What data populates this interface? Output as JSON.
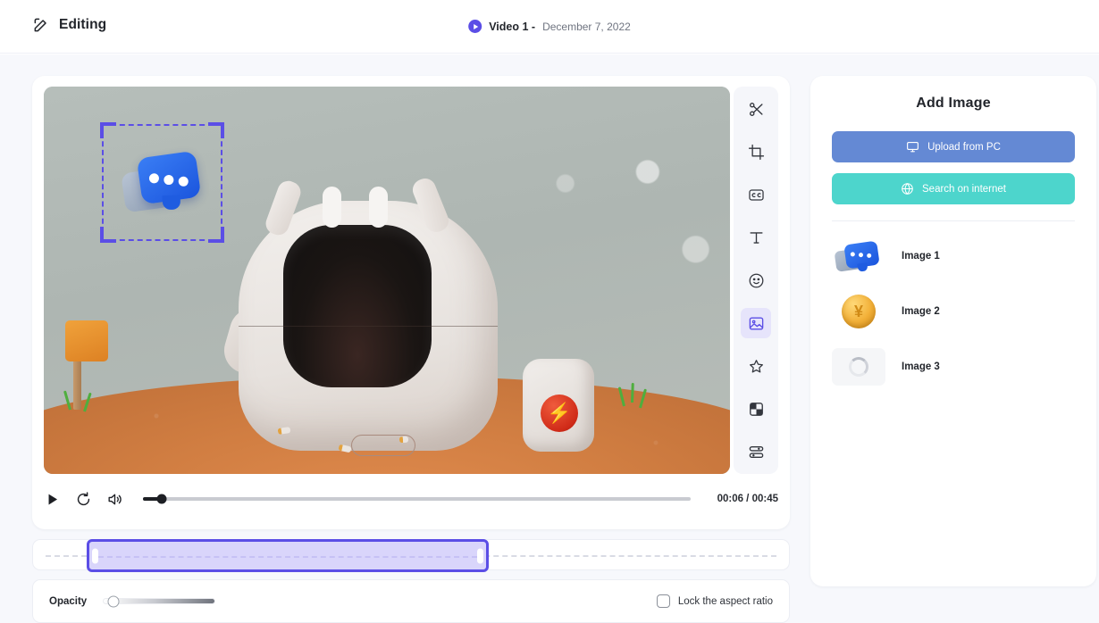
{
  "header": {
    "edit_icon": "edit-square-icon",
    "editing_label": "Editing",
    "play_icon": "play-circle-icon",
    "video_title": "Video 1 -",
    "video_date": "December 7, 2022"
  },
  "toolbar": {
    "items": [
      {
        "name": "cut-tool",
        "icon": "scissors-icon",
        "active": false
      },
      {
        "name": "crop-tool",
        "icon": "crop-icon",
        "active": false
      },
      {
        "name": "captions-tool",
        "icon": "closed-captions-icon",
        "active": false
      },
      {
        "name": "text-tool",
        "icon": "text-icon",
        "active": false
      },
      {
        "name": "sticker-tool",
        "icon": "smiley-icon",
        "active": false
      },
      {
        "name": "image-tool",
        "icon": "image-icon",
        "active": true
      },
      {
        "name": "effects-tool",
        "icon": "star-icon",
        "active": false
      },
      {
        "name": "transition-tool",
        "icon": "checkerboard-icon",
        "active": false
      },
      {
        "name": "adjustments-tool",
        "icon": "sliders-icon",
        "active": false
      }
    ]
  },
  "player": {
    "play_icon": "play-icon",
    "restart_icon": "restart-icon",
    "volume_icon": "volume-icon",
    "current_time": "00:06",
    "total_time": "00:45",
    "time_display": "00:06 / 00:45",
    "progress_percent": 3.5
  },
  "timeline": {
    "selection_start_percent": 7,
    "selection_width_percent": 54,
    "accent_color": "#5b4ee6",
    "fill_color": "#d9d5fb"
  },
  "bottom": {
    "opacity_label": "Opacity",
    "opacity_value_percent": 9,
    "lock_aspect_label": "Lock the aspect ratio",
    "lock_aspect_checked": false
  },
  "panel": {
    "title": "Add Image",
    "upload_button": {
      "label": "Upload from PC",
      "icon": "monitor-icon",
      "color": "#6489d4"
    },
    "search_button": {
      "label": "Search on internet",
      "icon": "globe-icon",
      "color": "#4dd5cc"
    },
    "images": [
      {
        "label": "Image 1",
        "thumb": "chat-bubble-thumb"
      },
      {
        "label": "Image 2",
        "thumb": "coin-thumb"
      },
      {
        "label": "Image 3",
        "thumb": "loading-spinner-thumb"
      }
    ]
  },
  "canvas": {
    "selection_label": "image-selection-box",
    "selected_asset": "chat-bubble-overlay"
  }
}
